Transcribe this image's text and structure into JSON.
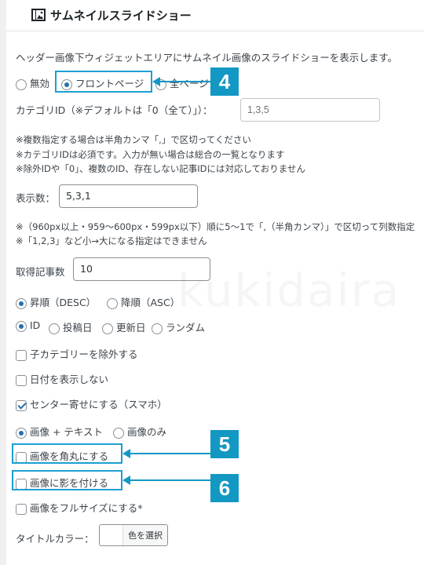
{
  "widget": {
    "title": "サムネイルスライドショー",
    "description": "ヘッダー画像下ウィジェットエリアにサムネイル画像のスライドショーを表示します。"
  },
  "display_target": {
    "options": [
      "無効",
      "フロントページ",
      "全ページ"
    ],
    "selected": "フロントページ"
  },
  "category": {
    "label": "カテゴリID（※デフォルトは「0（全て）」）：",
    "placeholder": "1,3,5"
  },
  "category_notes": [
    "※複数指定する場合は半角カンマ「,」で区切ってください",
    "※カテゴリIDは必須です。入力が無い場合は総合の一覧となります",
    "※除外IDや「0」、複数のID、存在しない記事IDには対応しておりません"
  ],
  "display_count": {
    "label": "表示数：",
    "value": "5,3,1"
  },
  "display_notes": [
    "※（960px以上・959〜600px・599px以下）順に5〜1で「,（半角カンマ）」で区切って列数指定",
    "※「1,2,3」など小→大になる指定はできません"
  ],
  "fetch_count": {
    "label": "取得記事数",
    "value": "10"
  },
  "order": {
    "options": [
      "昇順（DESC）",
      "降順（ASC）"
    ],
    "selected": "昇順（DESC）"
  },
  "orderby": {
    "options": [
      "ID",
      "投稿日",
      "更新日",
      "ランダム"
    ],
    "selected": "ID"
  },
  "checkboxes": {
    "exclude_child": "子カテゴリーを除外する",
    "hide_date": "日付を表示しない",
    "center": "センター寄せにする（スマホ）"
  },
  "display_mode": {
    "options": [
      "画像 + テキスト",
      "画像のみ"
    ],
    "selected": "画像 + テキスト"
  },
  "image_options": {
    "rounded": "画像を角丸にする",
    "shadow": "画像に影を付ける",
    "fullsize": "画像をフルサイズにする*"
  },
  "title_color": {
    "label": "タイトルカラー：",
    "button": "色を選択"
  },
  "watermark": "kukidaira",
  "callouts": [
    "4",
    "5",
    "6"
  ],
  "colors": {
    "accent": "#2271b1",
    "callout": "#1398c4"
  }
}
